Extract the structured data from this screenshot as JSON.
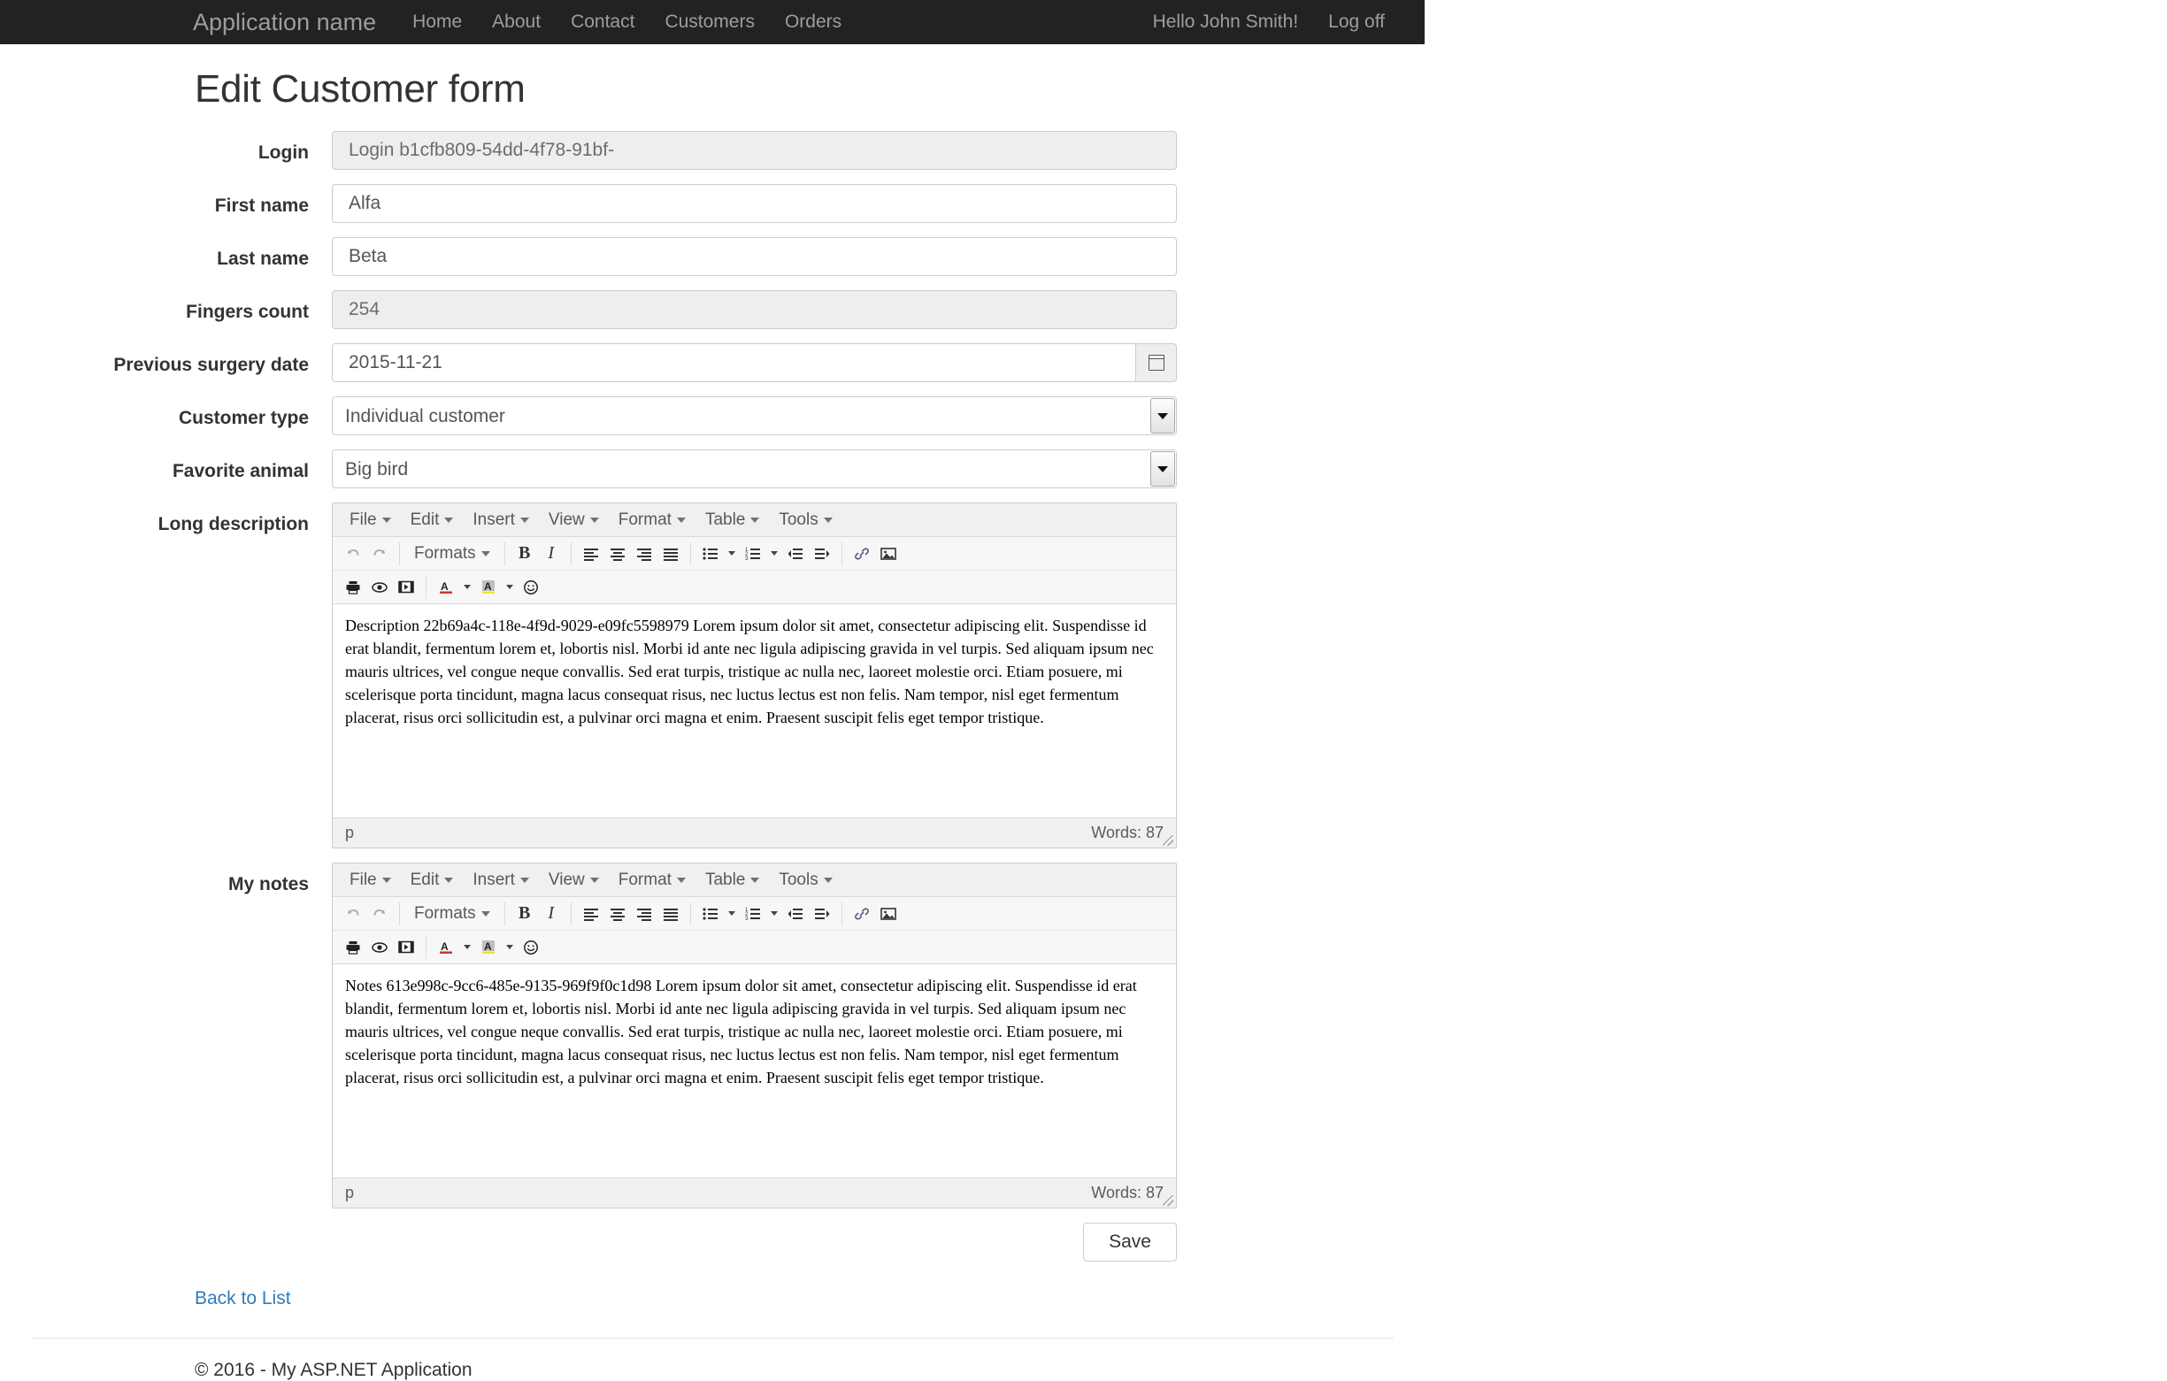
{
  "navbar": {
    "brand": "Application name",
    "links": [
      {
        "label": "Home"
      },
      {
        "label": "About"
      },
      {
        "label": "Contact"
      },
      {
        "label": "Customers"
      },
      {
        "label": "Orders"
      }
    ],
    "right_links": [
      {
        "label": "Hello John Smith!"
      },
      {
        "label": "Log off"
      }
    ]
  },
  "page": {
    "title": "Edit Customer form"
  },
  "form": {
    "login": {
      "label": "Login",
      "value": "Login b1cfb809-54dd-4f78-91bf-",
      "readonly": true
    },
    "first_name": {
      "label": "First name",
      "value": "Alfa",
      "readonly": false
    },
    "last_name": {
      "label": "Last name",
      "value": "Beta",
      "readonly": false
    },
    "fingers_count": {
      "label": "Fingers count",
      "value": "254",
      "readonly": true
    },
    "surgery_date": {
      "label": "Previous surgery date",
      "value": "2015-11-21",
      "addon_icon": "calendar-icon"
    },
    "customer_type": {
      "label": "Customer type",
      "value": "Individual customer",
      "options": [
        "Individual customer"
      ]
    },
    "favorite_animal": {
      "label": "Favorite animal",
      "value": "Big bird",
      "options": [
        "Big bird"
      ]
    },
    "long_description": {
      "label": "Long description",
      "body": "Description 22b69a4c-118e-4f9d-9029-e09fc5598979 Lorem ipsum dolor sit amet, consectetur adipiscing elit. Suspendisse id erat blandit, fermentum lorem et, lobortis nisl. Morbi id ante nec ligula adipiscing gravida in vel turpis. Sed aliquam ipsum nec mauris ultrices, vel congue neque convallis. Sed erat turpis, tristique ac nulla nec, laoreet molestie orci. Etiam posuere, mi scelerisque porta tincidunt, magna lacus consequat risus, nec luctus lectus est non felis. Nam tempor, nisl eget fermentum placerat, risus orci sollicitudin est, a pulvinar orci magna et enim. Praesent suscipit felis eget tempor tristique.",
      "status_path": "p",
      "status_words": "Words: 87"
    },
    "my_notes": {
      "label": "My notes",
      "body": "Notes 613e998c-9cc6-485e-9135-969f9f0c1d98 Lorem ipsum dolor sit amet, consectetur adipiscing elit. Suspendisse id erat blandit, fermentum lorem et, lobortis nisl. Morbi id ante nec ligula adipiscing gravida in vel turpis. Sed aliquam ipsum nec mauris ultrices, vel congue neque convallis. Sed erat turpis, tristique ac nulla nec, laoreet molestie orci. Etiam posuere, mi scelerisque porta tincidunt, magna lacus consequat risus, nec luctus lectus est non felis. Nam tempor, nisl eget fermentum placerat, risus orci sollicitudin est, a pulvinar orci magna et enim. Praesent suscipit felis eget tempor tristique.",
      "status_path": "p",
      "status_words": "Words: 87"
    },
    "save_label": "Save"
  },
  "editor_menus": [
    {
      "label": "File"
    },
    {
      "label": "Edit"
    },
    {
      "label": "Insert"
    },
    {
      "label": "View"
    },
    {
      "label": "Format"
    },
    {
      "label": "Table"
    },
    {
      "label": "Tools"
    }
  ],
  "editor_toolbar_row2": {
    "undo": "undo-icon",
    "redo": "redo-icon",
    "formats_label": "Formats",
    "bold": "B",
    "italic": "I"
  },
  "links": {
    "back_to_list": "Back to List"
  },
  "footer": {
    "copyright": "© 2016 - My ASP.NET Application"
  },
  "colors": {
    "navbar_bg": "#222222",
    "nav_text": "#9d9d9d",
    "link": "#337ab7",
    "readonly_bg": "#eeeeee",
    "border": "#cccccc"
  }
}
